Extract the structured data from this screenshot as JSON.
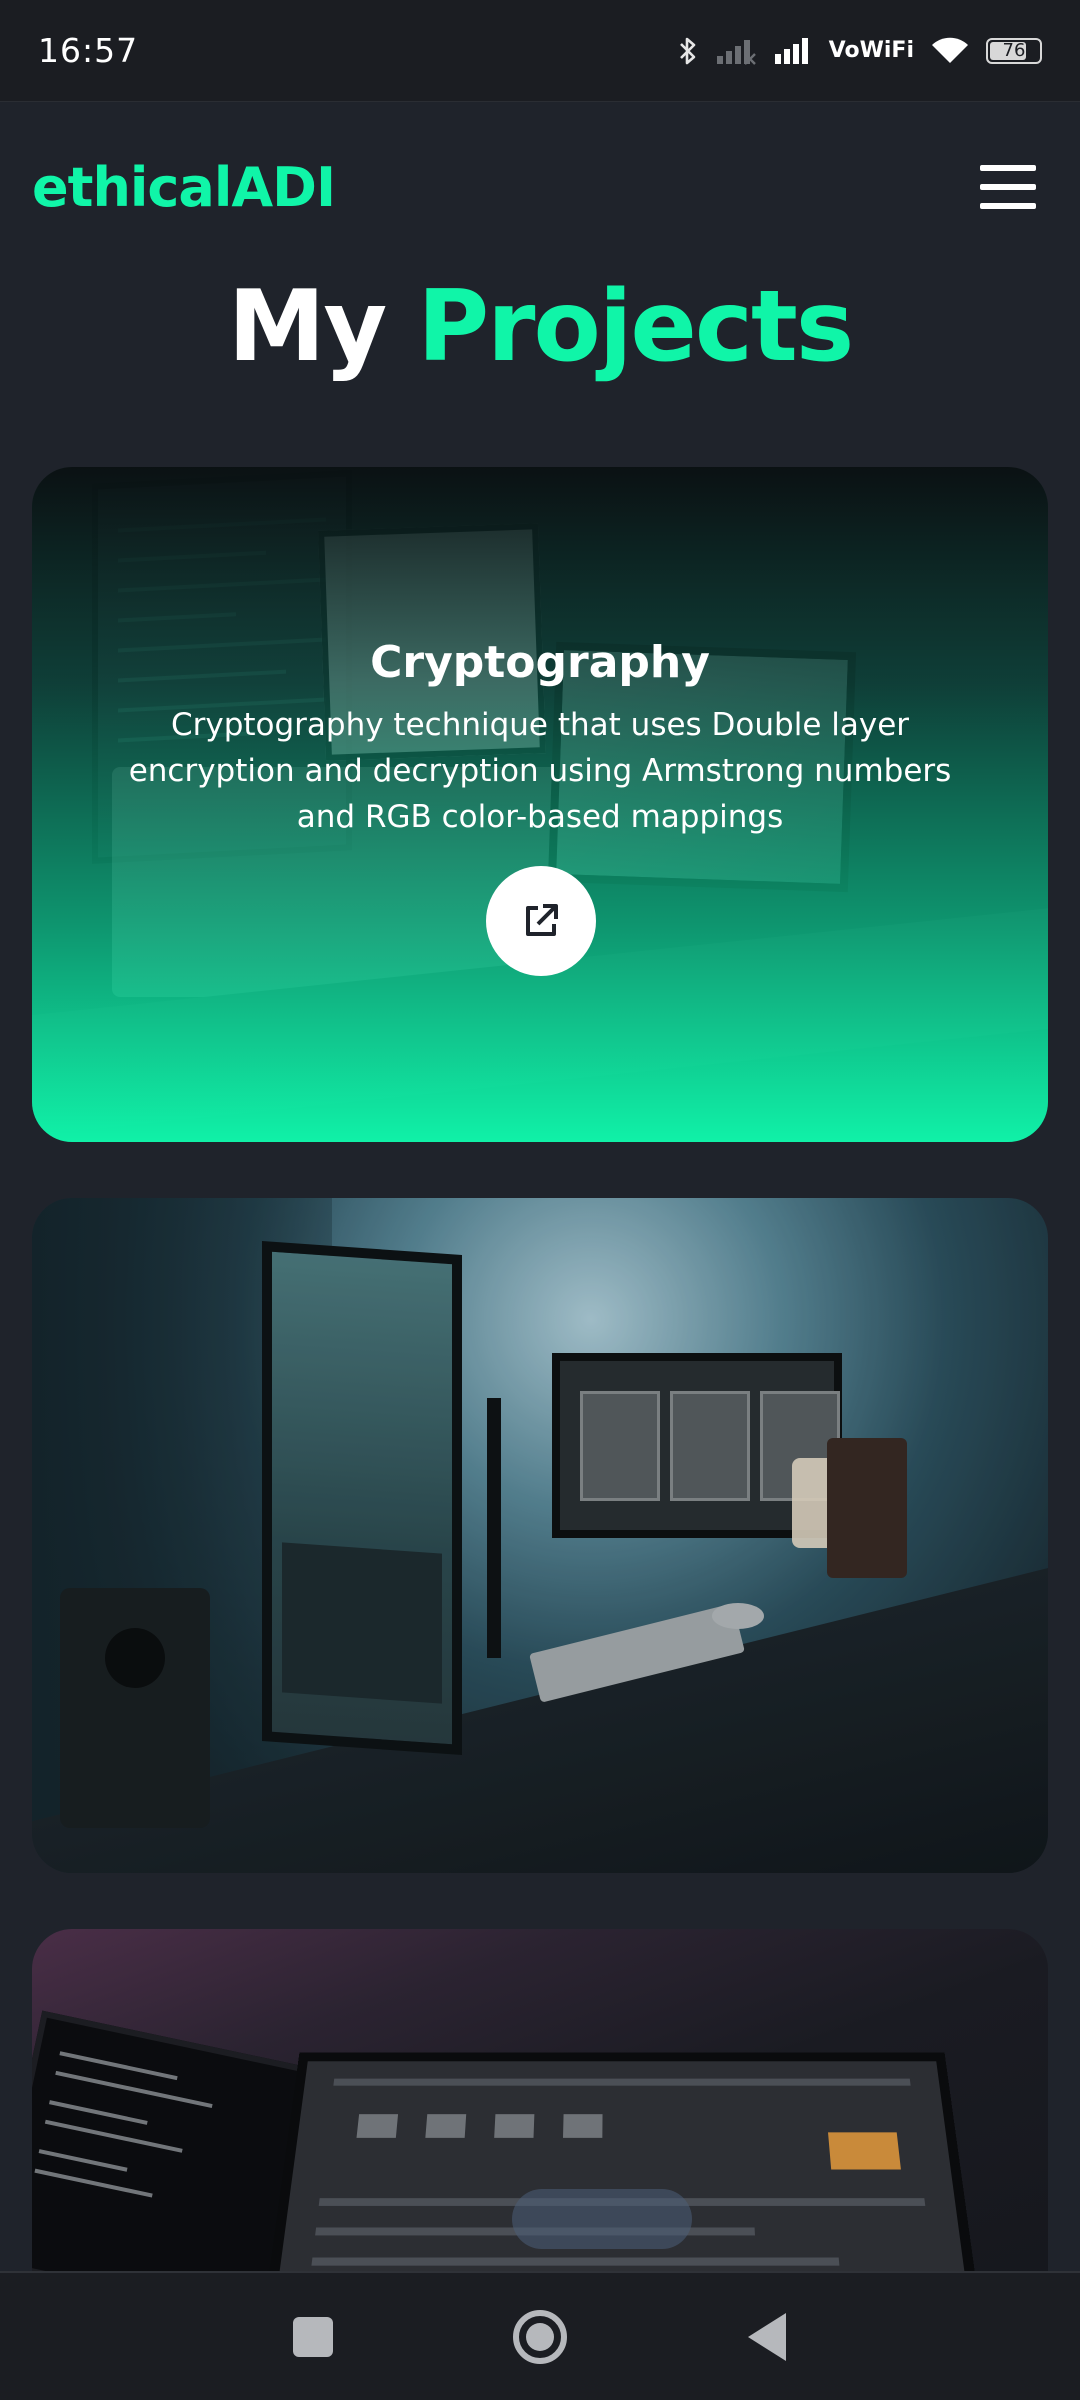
{
  "status_bar": {
    "time": "16:57",
    "icons": [
      "bluetooth-icon",
      "signal-off-icon",
      "signal-icon",
      "vowifi-icon",
      "wifi-icon",
      "battery-icon"
    ],
    "vowifi_line1": "Vo",
    "vowifi_line2": "WiFi",
    "battery_level": "76",
    "battery_fraction": 0.76
  },
  "header": {
    "logo": "ethicalADI",
    "menu_icon": "hamburger-menu-icon"
  },
  "page_title": {
    "word1": "My",
    "word2": "Projects"
  },
  "projects": [
    {
      "title": "Cryptography",
      "description": "Cryptography technique that uses Double layer encryption and decryption using Armstrong numbers and RGB color-based mappings",
      "link_icon": "external-link-icon"
    },
    {
      "title": "",
      "description": ""
    },
    {
      "title": "",
      "description": ""
    }
  ],
  "nav_bar": {
    "buttons": [
      "recent-apps-icon",
      "home-icon",
      "back-icon"
    ]
  },
  "colors": {
    "accent": "#10f5a8",
    "background": "#1f232b",
    "status_bar": "#1b1d22",
    "text": "#ffffff"
  }
}
